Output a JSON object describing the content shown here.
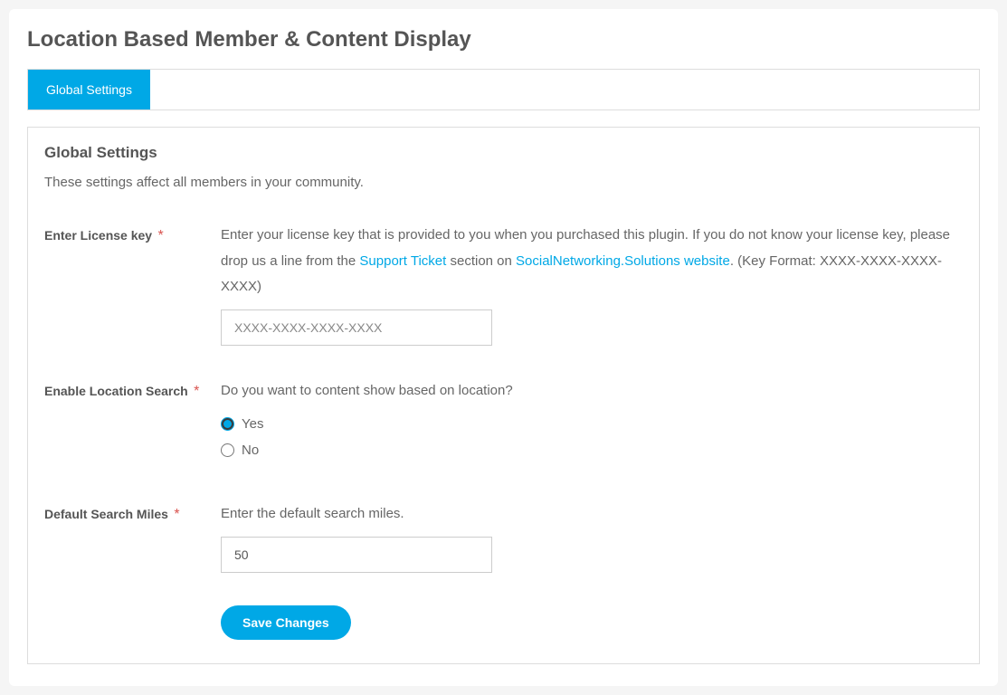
{
  "page": {
    "title": "Location Based Member & Content Display"
  },
  "tabs": {
    "global_settings": "Global Settings"
  },
  "panel": {
    "heading": "Global Settings",
    "subtext": "These settings affect all members in your community."
  },
  "fields": {
    "license_key": {
      "label": "Enter License key",
      "desc_before_link1": "Enter your license key that is provided to you when you purchased this plugin. If you do not know your license key, please drop us a line from the ",
      "link1_text": "Support Ticket",
      "desc_between": " section on ",
      "link2_text": "SocialNetworking.Solutions website",
      "desc_after_link2": ". (Key Format: XXXX-XXXX-XXXX-XXXX)",
      "placeholder": "XXXX-XXXX-XXXX-XXXX",
      "value": ""
    },
    "enable_location": {
      "label": "Enable Location Search",
      "desc": "Do you want to content show based on location?",
      "options": {
        "yes": "Yes",
        "no": "No"
      },
      "selected": "yes"
    },
    "default_miles": {
      "label": "Default Search Miles",
      "desc": "Enter the default search miles.",
      "value": "50"
    }
  },
  "buttons": {
    "save": "Save Changes"
  },
  "asterisk": "*"
}
